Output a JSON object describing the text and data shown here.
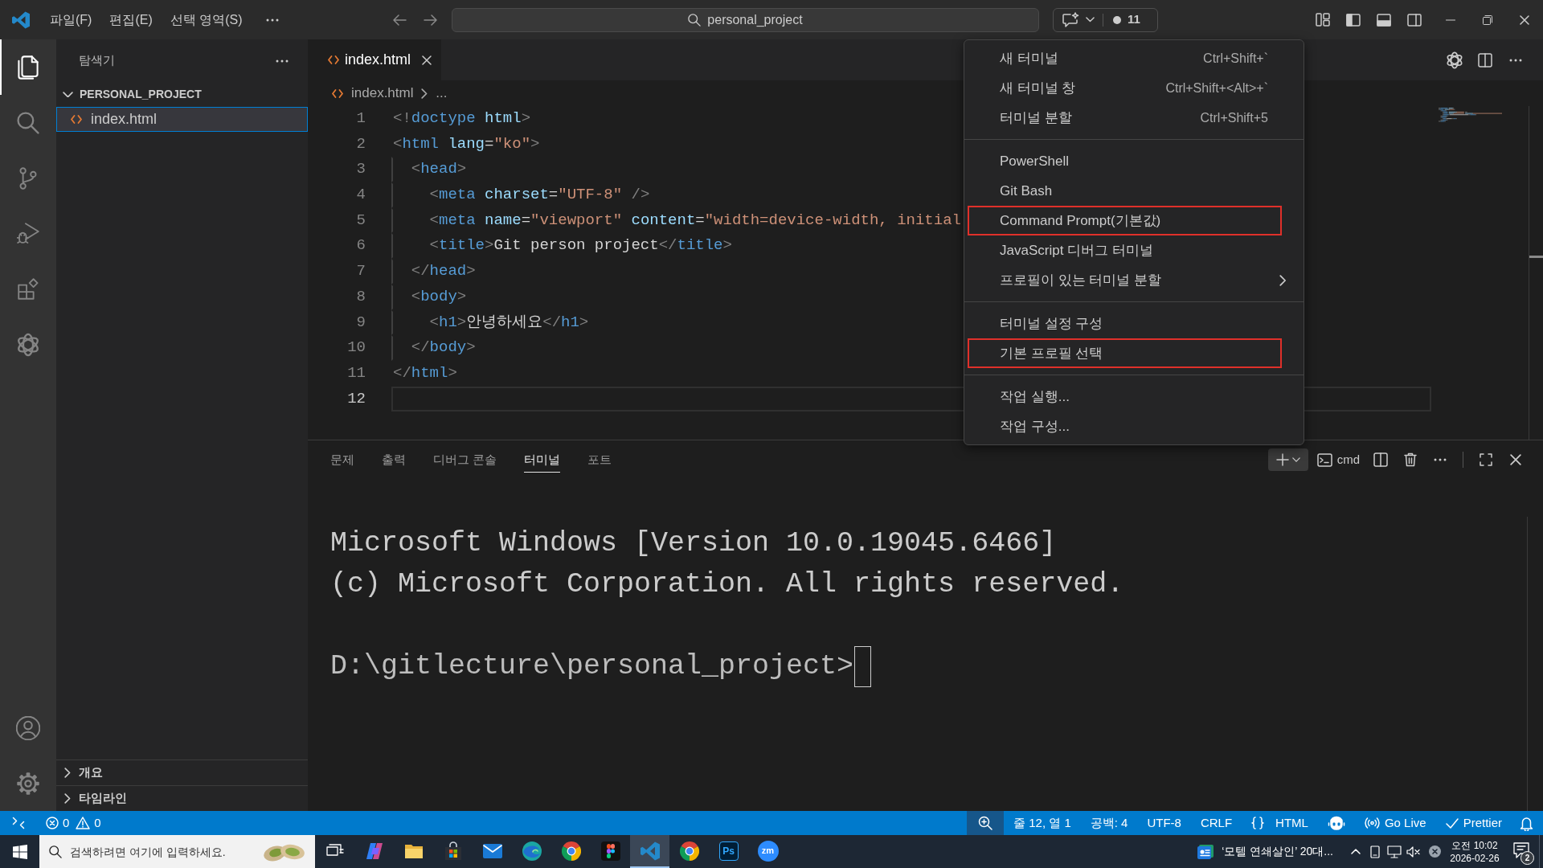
{
  "title_bar": {
    "menus": [
      {
        "label": "파일(F)"
      },
      {
        "label": "편집(E)"
      },
      {
        "label": "선택 영역(S)"
      }
    ],
    "search": "personal_project",
    "chat_count": "11"
  },
  "activity_bar": {
    "items": [
      {
        "kind": "explorer",
        "selected": true
      },
      {
        "kind": "search",
        "selected": false
      },
      {
        "kind": "source_control",
        "selected": false
      },
      {
        "kind": "run_debug",
        "selected": false
      },
      {
        "kind": "extensions",
        "selected": false
      },
      {
        "kind": "chatgpt",
        "selected": false
      }
    ],
    "bottom": [
      {
        "kind": "account"
      },
      {
        "kind": "settings"
      }
    ]
  },
  "sidebar": {
    "title": "탐색기",
    "tree": [
      {
        "kind": "folder",
        "name": "PERSONAL_PROJECT",
        "expanded": true,
        "children": [
          {
            "kind": "file",
            "name": "index.html",
            "selected": true
          }
        ]
      }
    ],
    "sections": [
      {
        "name": "개요",
        "expanded": false
      },
      {
        "name": "타임라인",
        "expanded": false
      }
    ]
  },
  "editor": {
    "tabs": [
      {
        "label": "index.html",
        "selected": true
      }
    ],
    "breadcrumb": [
      "index.html",
      "..."
    ],
    "lines": [
      {
        "number": "1",
        "current": false,
        "tokens": [
          {
            "kind": "punct",
            "text": "<!"
          },
          {
            "kind": "tag",
            "text": "doctype"
          },
          {
            "kind": "attr",
            "text": " html"
          },
          {
            "kind": "punct",
            "text": ">"
          }
        ]
      },
      {
        "number": "2",
        "current": false,
        "tokens": [
          {
            "kind": "punct",
            "text": "<"
          },
          {
            "kind": "tag",
            "text": "html"
          },
          {
            "kind": "attr",
            "text": " lang"
          },
          {
            "kind": "text",
            "text": "="
          },
          {
            "kind": "string",
            "text": "\"ko\""
          },
          {
            "kind": "punct",
            "text": ">"
          }
        ]
      },
      {
        "number": "3",
        "current": false,
        "tokens": [
          {
            "kind": "punct",
            "text": "  <"
          },
          {
            "kind": "tag",
            "text": "head"
          },
          {
            "kind": "punct",
            "text": ">"
          }
        ]
      },
      {
        "number": "4",
        "current": false,
        "tokens": [
          {
            "kind": "punct",
            "text": "    <"
          },
          {
            "kind": "tag",
            "text": "meta"
          },
          {
            "kind": "attr",
            "text": " charset"
          },
          {
            "kind": "text",
            "text": "="
          },
          {
            "kind": "string",
            "text": "\"UTF-8\""
          },
          {
            "kind": "punct",
            "text": " />"
          }
        ]
      },
      {
        "number": "5",
        "current": false,
        "tokens": [
          {
            "kind": "punct",
            "text": "    <"
          },
          {
            "kind": "tag",
            "text": "meta"
          },
          {
            "kind": "attr",
            "text": " name"
          },
          {
            "kind": "text",
            "text": "="
          },
          {
            "kind": "string",
            "text": "\"viewport\""
          },
          {
            "kind": "attr",
            "text": " content"
          },
          {
            "kind": "text",
            "text": "="
          },
          {
            "kind": "string",
            "text": "\"width=device-width, initial"
          }
        ]
      },
      {
        "number": "6",
        "current": false,
        "tokens": [
          {
            "kind": "punct",
            "text": "    <"
          },
          {
            "kind": "tag",
            "text": "title"
          },
          {
            "kind": "punct",
            "text": ">"
          },
          {
            "kind": "text",
            "text": "Git person project"
          },
          {
            "kind": "punct",
            "text": "</"
          },
          {
            "kind": "tag",
            "text": "title"
          },
          {
            "kind": "punct",
            "text": ">"
          }
        ]
      },
      {
        "number": "7",
        "current": false,
        "tokens": [
          {
            "kind": "punct",
            "text": "  </"
          },
          {
            "kind": "tag",
            "text": "head"
          },
          {
            "kind": "punct",
            "text": ">"
          }
        ]
      },
      {
        "number": "8",
        "current": false,
        "tokens": [
          {
            "kind": "punct",
            "text": "  <"
          },
          {
            "kind": "tag",
            "text": "body"
          },
          {
            "kind": "punct",
            "text": ">"
          }
        ]
      },
      {
        "number": "9",
        "current": false,
        "tokens": [
          {
            "kind": "punct",
            "text": "    <"
          },
          {
            "kind": "tag",
            "text": "h1"
          },
          {
            "kind": "punct",
            "text": ">"
          },
          {
            "kind": "text",
            "text": "안녕하세요"
          },
          {
            "kind": "punct",
            "text": "</"
          },
          {
            "kind": "tag",
            "text": "h1"
          },
          {
            "kind": "punct",
            "text": ">"
          }
        ]
      },
      {
        "number": "10",
        "current": false,
        "tokens": [
          {
            "kind": "punct",
            "text": "  </"
          },
          {
            "kind": "tag",
            "text": "body"
          },
          {
            "kind": "punct",
            "text": ">"
          }
        ]
      },
      {
        "number": "11",
        "current": false,
        "tokens": [
          {
            "kind": "punct",
            "text": "</"
          },
          {
            "kind": "tag",
            "text": "html"
          },
          {
            "kind": "punct",
            "text": ">"
          }
        ]
      },
      {
        "number": "12",
        "current": true
      }
    ]
  },
  "context_menu": {
    "groups": [
      {
        "items": [
          {
            "label": "새 터미널",
            "shortcut": "Ctrl+Shift+`",
            "submenu": false,
            "highlighted": false
          },
          {
            "label": "새 터미널 창",
            "shortcut": "Ctrl+Shift+<Alt>+`",
            "submenu": false,
            "highlighted": false
          },
          {
            "label": "터미널 분할",
            "shortcut": "Ctrl+Shift+5",
            "submenu": false,
            "highlighted": false
          }
        ]
      },
      {
        "items": [
          {
            "label": "PowerShell",
            "submenu": false,
            "highlighted": false
          },
          {
            "label": "Git Bash",
            "submenu": false,
            "highlighted": false
          },
          {
            "label": "Command Prompt(기본값)",
            "submenu": false,
            "highlighted": true
          },
          {
            "label": "JavaScript 디버그 터미널",
            "submenu": false,
            "highlighted": false
          },
          {
            "label": "프로필이 있는 터미널 분할",
            "submenu": true,
            "highlighted": false
          }
        ]
      },
      {
        "items": [
          {
            "label": "터미널 설정 구성",
            "submenu": false,
            "highlighted": false
          },
          {
            "label": "기본 프로필 선택",
            "submenu": false,
            "highlighted": true
          }
        ]
      },
      {
        "items": [
          {
            "label": "작업 실행...",
            "submenu": false,
            "highlighted": false
          },
          {
            "label": "작업 구성...",
            "submenu": false,
            "highlighted": false
          }
        ]
      }
    ]
  },
  "panel": {
    "tabs": [
      {
        "label": "문제",
        "selected": false
      },
      {
        "label": "출력",
        "selected": false
      },
      {
        "label": "디버그 콘솔",
        "selected": false
      },
      {
        "label": "터미널",
        "selected": true
      },
      {
        "label": "포트",
        "selected": false
      }
    ],
    "terminal_name": "cmd",
    "terminal": {
      "lines": [
        "Microsoft Windows [Version 10.0.19045.6466]",
        "(c) Microsoft Corporation. All rights reserved."
      ],
      "prompt": "D:\\gitlecture\\personal_project>"
    }
  },
  "status_bar": {
    "errors": "0",
    "warnings": "0",
    "position": "줄 12, 열 1",
    "indent": "공백: 4",
    "encoding": "UTF-8",
    "eol": "CRLF",
    "language": "HTML",
    "live_server": "Go Live",
    "formatter": "Prettier"
  },
  "taskbar": {
    "search_placeholder": "검색하려면 여기에 입력하세요.",
    "apps": [
      {
        "kind": "task_view",
        "selected": false
      },
      {
        "kind": "copilot",
        "selected": false
      },
      {
        "kind": "file_explorer",
        "selected": false
      },
      {
        "kind": "store",
        "selected": false
      },
      {
        "kind": "mail",
        "selected": false
      },
      {
        "kind": "edge",
        "selected": false
      },
      {
        "kind": "chrome",
        "selected": false
      },
      {
        "kind": "figma",
        "selected": false
      },
      {
        "kind": "vscode",
        "selected": true
      },
      {
        "kind": "chrome",
        "selected": false
      },
      {
        "kind": "photoshop",
        "label": "Ps",
        "selected": false
      },
      {
        "kind": "zoom",
        "label": "zm",
        "selected": false
      }
    ],
    "news": "‘모텔 연쇄살인’ 20대...",
    "time": "오전 10:02",
    "date": "2026-02-26",
    "notifications": "2"
  }
}
